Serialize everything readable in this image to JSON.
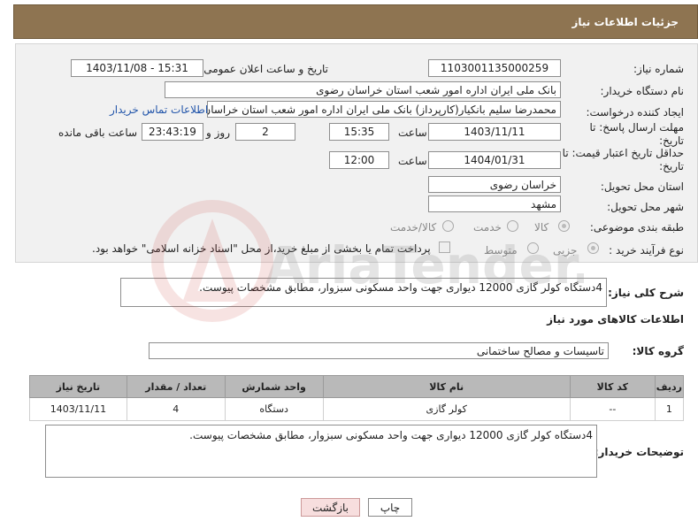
{
  "header": {
    "title": "جزئیات اطلاعات نیاز"
  },
  "form": {
    "need_number_label": "شماره نیاز:",
    "need_number": "1103001135000259",
    "announce_label": "تاریخ و ساعت اعلان عمومی:",
    "announce_value": "1403/11/08 - 15:31",
    "buyer_org_label": "نام دستگاه خریدار:",
    "buyer_org": "بانک ملی ایران اداره امور شعب استان خراسان رضوی",
    "requester_label": "ایجاد کننده درخواست:",
    "requester": "محمدرضا سلیم  بانکیار(کارپرداز) بانک ملی ایران اداره امور شعب استان خراسان",
    "contact_link": "اطلاعات تماس خریدار",
    "deadline_label_1": "مهلت ارسال پاسخ: تا",
    "deadline_label_2": "تاریخ:",
    "deadline_date": "1403/11/11",
    "time_label": "ساعت",
    "deadline_time": "15:35",
    "days_value": "2",
    "days_label": "روز و",
    "remaining_time": "23:43:19",
    "remaining_label": "ساعت باقی مانده",
    "validity_label_1": "حداقل تاریخ اعتبار قیمت: تا",
    "validity_label_2": "تاریخ:",
    "validity_date": "1404/01/31",
    "validity_time_label": "ساعت",
    "validity_time": "12:00",
    "province_label": "استان محل تحویل:",
    "province": "خراسان رضوی",
    "city_label": "شهر محل تحویل:",
    "city": "مشهد",
    "category_label": "طبقه بندی موضوعی:",
    "category_goods": "کالا",
    "category_service": "خدمت",
    "category_both": "کالا/خدمت",
    "process_label": "نوع فرآیند خرید :",
    "process_partial": "جزیی",
    "process_medium": "متوسط",
    "payment_note": "پرداخت تمام یا بخشی از مبلغ خرید،از محل \"اسناد خزانه اسلامی\" خواهد بود.",
    "description_label": "شرح کلی نیاز:",
    "description": "4دستگاه کولر گازی 12000 دیواری جهت واحد مسکونی سبزوار، مطابق مشخصات پیوست."
  },
  "goods": {
    "section_title": "اطلاعات کالاهای مورد نیاز",
    "group_label": "گروه کالا:",
    "group_value": "تاسیسات و مصالح ساختمانی",
    "columns": [
      "ردیف",
      "کد کالا",
      "نام کالا",
      "واحد شمارش",
      "تعداد / مقدار",
      "تاریخ نیاز"
    ],
    "rows": [
      [
        "1",
        "--",
        "کولر گازی",
        "دستگاه",
        "4",
        "1403/11/11"
      ]
    ]
  },
  "buyer_notes": {
    "label": "توضیحات خریدار:",
    "text": "4دستگاه کولر گازی 12000 دیواری جهت واحد مسکونی سبزوار، مطابق مشخصات پیوست."
  },
  "buttons": {
    "print": "چاپ",
    "back": "بازگشت"
  },
  "watermark": {
    "brand": "AriaTender.neT"
  },
  "colors": {
    "header_bg": "#8e7451",
    "panel_bg": "#f1f1f1",
    "table_head": "#b9b9b9"
  }
}
